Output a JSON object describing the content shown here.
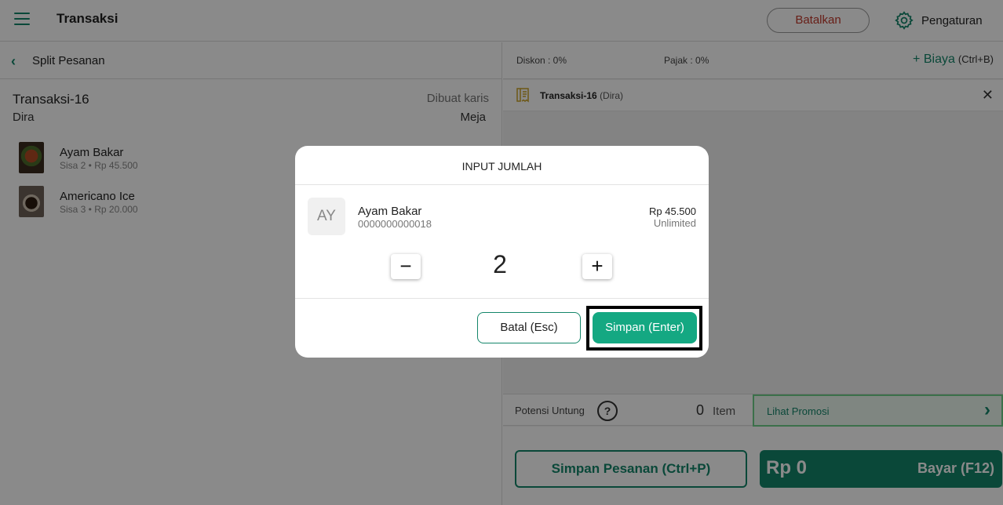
{
  "header": {
    "title": "Transaksi",
    "cancel_label": "Batalkan",
    "settings_label": "Pengaturan"
  },
  "left": {
    "subheader_title": "Split Pesanan",
    "transaction_name": "Transaksi-16",
    "customer": "Dira",
    "created_by": "Dibuat karis",
    "table": "Meja",
    "items": [
      {
        "name": "Ayam Bakar",
        "sub": "Sisa 2 • Rp 45.500"
      },
      {
        "name": "Americano Ice",
        "sub": "Sisa 3 • Rp 20.000"
      }
    ]
  },
  "right": {
    "discount": "Diskon : 0%",
    "tax": "Pajak : 0%",
    "add_fee": "+ Biaya",
    "add_fee_shortcut": "(Ctrl+B)",
    "tab_label": "Transaksi-16",
    "tab_customer": "(Dira)",
    "profit_label": "Potensi Untung",
    "item_count": "0",
    "item_label": "Item",
    "promo_label": "Lihat Promosi",
    "save_order_label": "Simpan Pesanan (Ctrl+P)",
    "pay_total": "Rp 0",
    "pay_label": "Bayar (F12)"
  },
  "modal": {
    "title": "INPUT JUMLAH",
    "avatar_initials": "AY",
    "product_name": "Ayam Bakar",
    "product_code": "0000000000018",
    "price": "Rp 45.500",
    "stock": "Unlimited",
    "quantity": "2",
    "minus_symbol": "−",
    "plus_symbol": "+",
    "cancel_label": "Batal (Esc)",
    "save_label": "Simpan (Enter)"
  },
  "icons": {
    "menu": "hamburger-menu-icon",
    "settings": "gear-icon",
    "back": "chevron-left-icon",
    "receipt": "receipt-icon",
    "close": "close-icon",
    "help": "question-circle-icon",
    "promo": "chevron-right-icon"
  },
  "colors": {
    "brand": "#14866a",
    "danger": "#c0392b",
    "primary_button": "#14a882"
  }
}
